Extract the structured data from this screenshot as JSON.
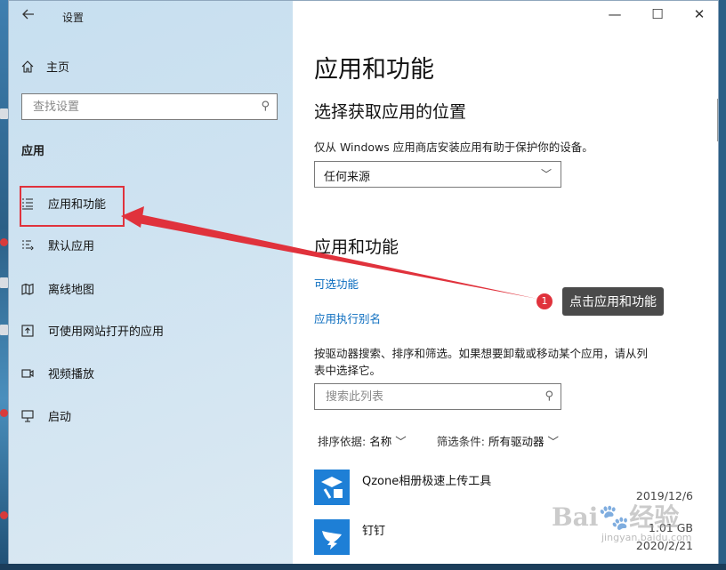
{
  "window": {
    "title": "设置",
    "back_icon": "back-arrow-icon",
    "controls": [
      "minimize-icon",
      "maximize-icon",
      "close-icon"
    ]
  },
  "sidebar": {
    "home_label": "主页",
    "search_placeholder": "查找设置",
    "section_label": "应用",
    "items": [
      {
        "label": "应用和功能",
        "icon": "apps-list-icon",
        "selected": true
      },
      {
        "label": "默认应用",
        "icon": "default-apps-icon",
        "selected": false
      },
      {
        "label": "离线地图",
        "icon": "map-icon",
        "selected": false
      },
      {
        "label": "可使用网站打开的应用",
        "icon": "website-apps-icon",
        "selected": false
      },
      {
        "label": "视频播放",
        "icon": "video-icon",
        "selected": false
      },
      {
        "label": "启动",
        "icon": "startup-icon",
        "selected": false
      }
    ]
  },
  "main": {
    "page_title": "应用和功能",
    "source_heading": "选择获取应用的位置",
    "source_desc": "仅从 Windows 应用商店安装应用有助于保护你的设备。",
    "source_select_value": "任何来源",
    "apps_heading": "应用和功能",
    "optional_features_link": "可选功能",
    "alias_link": "应用执行别名",
    "list_desc_line1": "按驱动器搜索、排序和筛选。如果想要卸载或移动某个应用，请从列",
    "list_desc_line2": "表中选择它。",
    "list_search_placeholder": "搜索此列表",
    "sort_label": "排序依据:",
    "sort_value": "名称",
    "filter_label": "筛选条件:",
    "filter_value": "所有驱动器",
    "apps": [
      {
        "name": "Qzone相册极速上传工具",
        "size": "",
        "date": "2019/12/6"
      },
      {
        "name": "钉钉",
        "size": "1.01 GB",
        "date": "2020/2/21"
      }
    ]
  },
  "annotation": {
    "badge_number": "1",
    "callout_text": "点击应用和功能",
    "highlight_color": "#e0323c"
  },
  "watermark": {
    "text": "Bai🐾经验",
    "sub": "jingyan.baidu.com"
  },
  "colors": {
    "link": "#0a6cbf",
    "accent_red": "#e0323c",
    "sidebar_bg": "#cfe3f1"
  }
}
